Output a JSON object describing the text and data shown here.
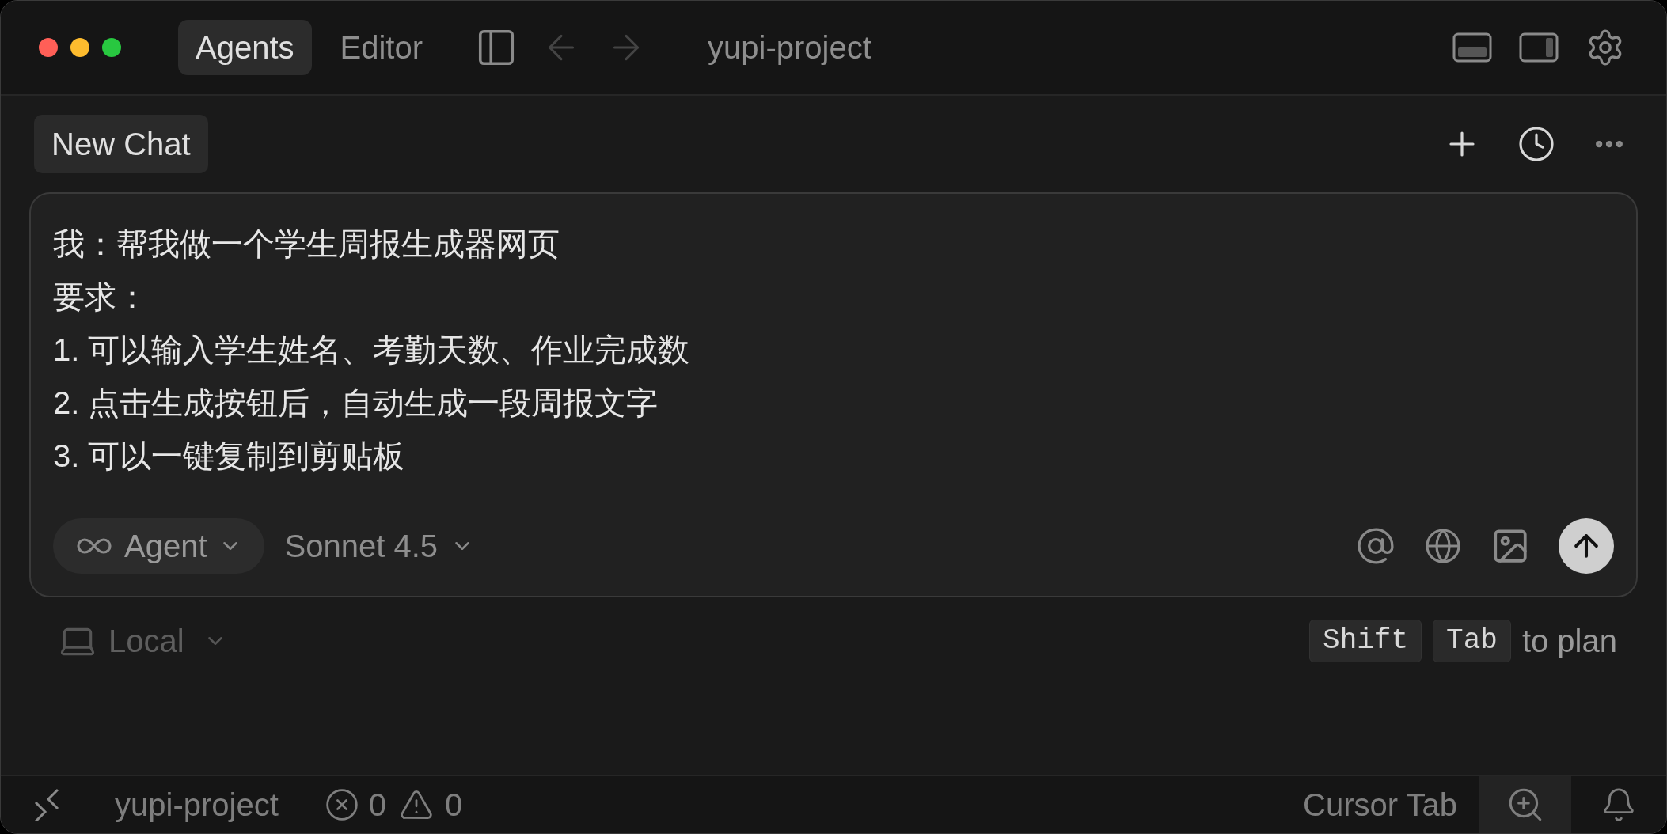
{
  "title_bar": {
    "tabs": [
      {
        "label": "Agents",
        "selected": true
      },
      {
        "label": "Editor",
        "selected": false
      }
    ],
    "title": "yupi-project"
  },
  "chat_header": {
    "title": "New Chat"
  },
  "prompt": {
    "lines": [
      "我：帮我做一个学生周报生成器网页",
      "要求：",
      "1. 可以输入学生姓名、考勤天数、作业完成数",
      "2. 点击生成按钮后，自动生成一段周报文字",
      "3. 可以一键复制到剪贴板"
    ]
  },
  "composer": {
    "mode": "Agent",
    "model": "Sonnet 4.5"
  },
  "footer": {
    "environment": "Local",
    "keys": [
      "Shift",
      "Tab"
    ],
    "hint": "to plan"
  },
  "status_bar": {
    "project": "yupi-project",
    "errors": "0",
    "warnings": "0",
    "cursor_tab": "Cursor Tab"
  }
}
